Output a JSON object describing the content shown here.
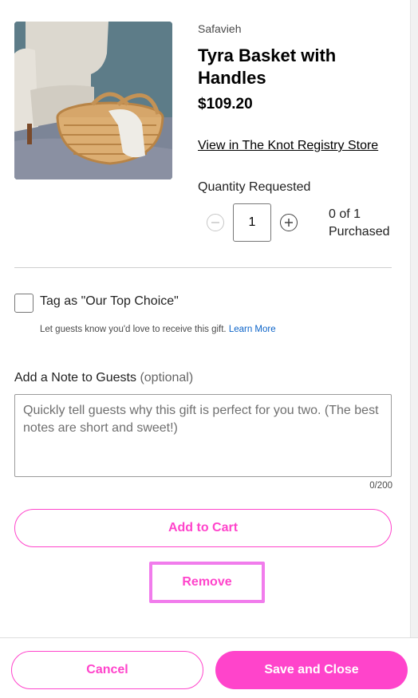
{
  "product": {
    "brand": "Safavieh",
    "title": "Tyra Basket with Handles",
    "price": "$109.20",
    "store_link": "View in The Knot Registry Store",
    "image_icon": "product-photo"
  },
  "quantity": {
    "label": "Quantity Requested",
    "value": "1",
    "purchased_line1": "0 of 1",
    "purchased_line2": "Purchased",
    "minus_icon": "minus-circle-icon",
    "plus_icon": "plus-circle-icon"
  },
  "top_choice": {
    "label": "Tag as \"Our Top Choice\"",
    "help": "Let guests know you'd love to receive this gift.",
    "learn_more": "Learn More",
    "checked": false
  },
  "note": {
    "label": "Add a Note to Guests",
    "optional": "(optional)",
    "placeholder": "Quickly tell guests why this gift is perfect for you two. (The best notes are short and sweet!)",
    "value": "",
    "char_count": "0/200"
  },
  "actions": {
    "add_to_cart": "Add to Cart",
    "remove": "Remove",
    "cancel": "Cancel",
    "save_and_close": "Save and Close"
  },
  "colors": {
    "accent": "#ff44cb",
    "highlight": "#f17cec",
    "link": "#0b63c8"
  }
}
